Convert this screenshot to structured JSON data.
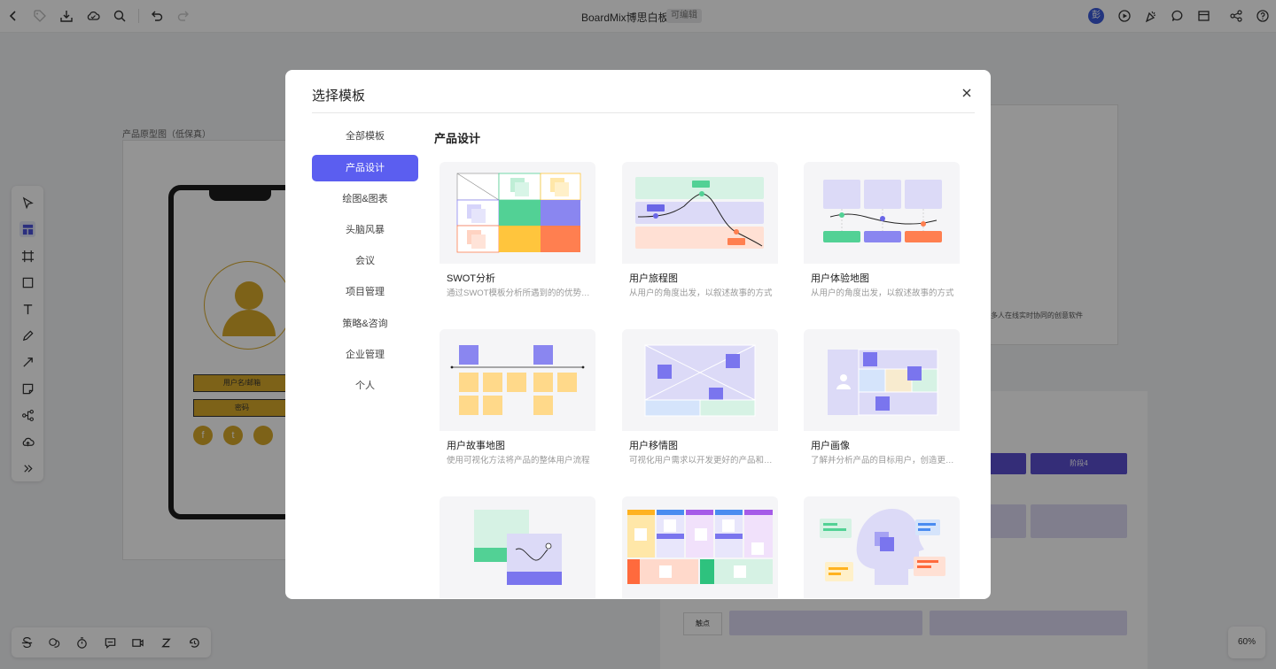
{
  "topbar": {
    "title": "BoardMix博思白板",
    "edit_badge": "可编辑",
    "avatar_text": "彭",
    "icons": [
      "back-icon",
      "tag-icon",
      "download-icon",
      "cloud-icon",
      "search-icon",
      "undo-icon",
      "redo-icon",
      "play-icon",
      "celebrate-icon",
      "comment-icon",
      "layout-icon",
      "share-icon",
      "help-icon"
    ]
  },
  "canvas": {
    "frame_label": "产品原型图（低保真）",
    "login_field_1": "用户名/邮箱",
    "login_field_2": "密码",
    "social_icons": [
      "f",
      "t",
      ""
    ],
    "right_frame_text": "多人在线实时协同的创意软件",
    "journey_stage": "阶段4",
    "journey_touch": "触点",
    "zoom": "60%"
  },
  "left_toolbar": {
    "icons": [
      "select-icon",
      "template-icon",
      "frame-icon",
      "shape-icon",
      "text-icon",
      "pen-icon",
      "line-icon",
      "sticky-note-icon",
      "mindmap-icon",
      "upload-icon",
      "more-icon"
    ],
    "active": "template-icon"
  },
  "bottom_toolbar": {
    "icons": [
      "strikethrough-icon",
      "chat-icon",
      "timer-icon",
      "message-icon",
      "video-icon",
      "sleep-icon",
      "history-icon"
    ]
  },
  "modal": {
    "title": "选择模板",
    "categories": [
      {
        "label": "全部模板",
        "active": false
      },
      {
        "label": "产品设计",
        "active": true
      },
      {
        "label": "绘图&图表",
        "active": false
      },
      {
        "label": "头脑风暴",
        "active": false
      },
      {
        "label": "会议",
        "active": false
      },
      {
        "label": "项目管理",
        "active": false
      },
      {
        "label": "策略&咨询",
        "active": false
      },
      {
        "label": "企业管理",
        "active": false
      },
      {
        "label": "个人",
        "active": false
      }
    ],
    "section_title": "产品设计",
    "templates": [
      {
        "title": "SWOT分析",
        "desc": "通过SWOT模板分析所遇到的的优势、劣势、机会和威胁"
      },
      {
        "title": "用户旅程图",
        "desc": "从用户的角度出发，以叙述故事的方式"
      },
      {
        "title": "用户体验地图",
        "desc": "从用户的角度出发，以叙述故事的方式"
      },
      {
        "title": "用户故事地图",
        "desc": "使用可视化方法将产品的整体用户流程"
      },
      {
        "title": "用户移情图",
        "desc": "可视化用户需求以开发更好的产品和服务"
      },
      {
        "title": "用户画像",
        "desc": "了解并分析产品的目标用户，创造更好的体验"
      },
      {
        "title": "",
        "desc": ""
      },
      {
        "title": "",
        "desc": ""
      },
      {
        "title": "",
        "desc": ""
      }
    ]
  },
  "colors": {
    "accent": "#5b5ef0",
    "green": "#52d195",
    "purple": "#8a86f0",
    "yellow": "#ffc53d",
    "orange": "#ff7f50"
  }
}
